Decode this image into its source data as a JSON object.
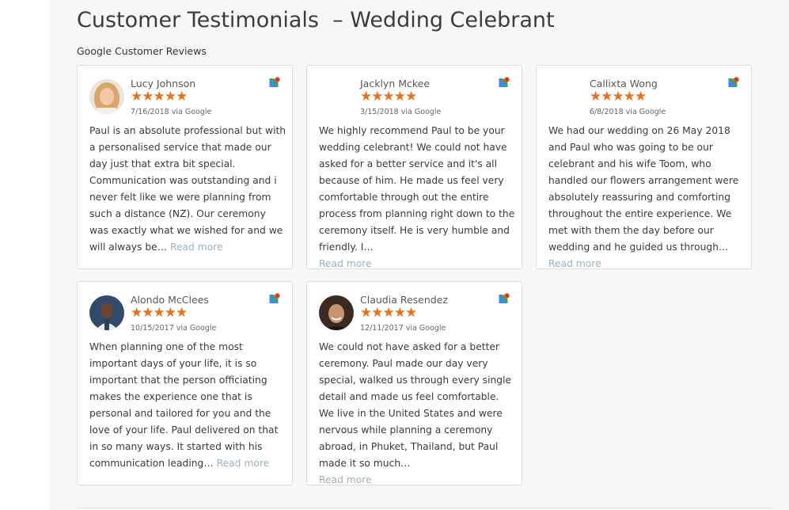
{
  "page": {
    "title": "Customer Testimonials  – Wedding Celebrant",
    "subtitle": "Google Customer Reviews"
  },
  "reviews": [
    {
      "name": "Lucy Johnson",
      "stars": "★★★★★",
      "date": "7/16/2018 via Google",
      "text": "Paul is an absolute professional but with a personalised service that made our day just that extra bit special. Communication was outstanding and i never felt like we were planning from such a distance (NZ). Our ceremony was exactly what we wished for and we will always be…",
      "read_more": "Read more",
      "has_avatar": true
    },
    {
      "name": "Jacklyn Mckee",
      "stars": "★★★★★",
      "date": "3/15/2018 via Google",
      "text": "We highly recommend Paul to be your wedding celebrant! We could not have asked for a better service and it's all because of him. He made us feel very comfortable through out the entire process from planning right down to the ceremony itself. He is very humble and friendly. I…",
      "read_more": "Read more",
      "has_avatar": false
    },
    {
      "name": "Callixta Wong",
      "stars": "★★★★★",
      "date": "6/8/2018 via Google",
      "text": "We had our wedding on 26 May 2018 and Paul who was going to be our celebrant and his wife Toom, who handled our flowers arrangement were absolutely reassuring and comforting throughout the entire experience. We met with them the day before our wedding and he guided us through…",
      "read_more": "Read more",
      "has_avatar": false
    },
    {
      "name": "Alondo McClees",
      "stars": "★★★★★",
      "date": "10/15/2017 via Google",
      "text": "When planning one of the most important days of your life, it is so important that the person officiating makes the experience one that is personal and tailored for you and the love of your life. Paul delivered on that in so many ways. It started with his communication leading…",
      "read_more": "Read more",
      "has_avatar": true
    },
    {
      "name": "Claudia Resendez",
      "stars": "★★★★★",
      "date": "12/11/2017 via Google",
      "text": "We could not have asked for a better ceremony. Paul made our day very special, walked us through every single detail and made us feel comfortable. We live in the United States and were nervous while planning a ceremony abroad, in Phuket, Thailand, but Paul made it so much…",
      "read_more": "Read more",
      "has_avatar": true
    }
  ],
  "colors": {
    "star": "#e7711b",
    "read_more": "#9bb0bd",
    "card_border": "#dcdcdc",
    "page_bg": "#f7f7f7"
  },
  "icons": {
    "source": "google-maps-icon"
  }
}
